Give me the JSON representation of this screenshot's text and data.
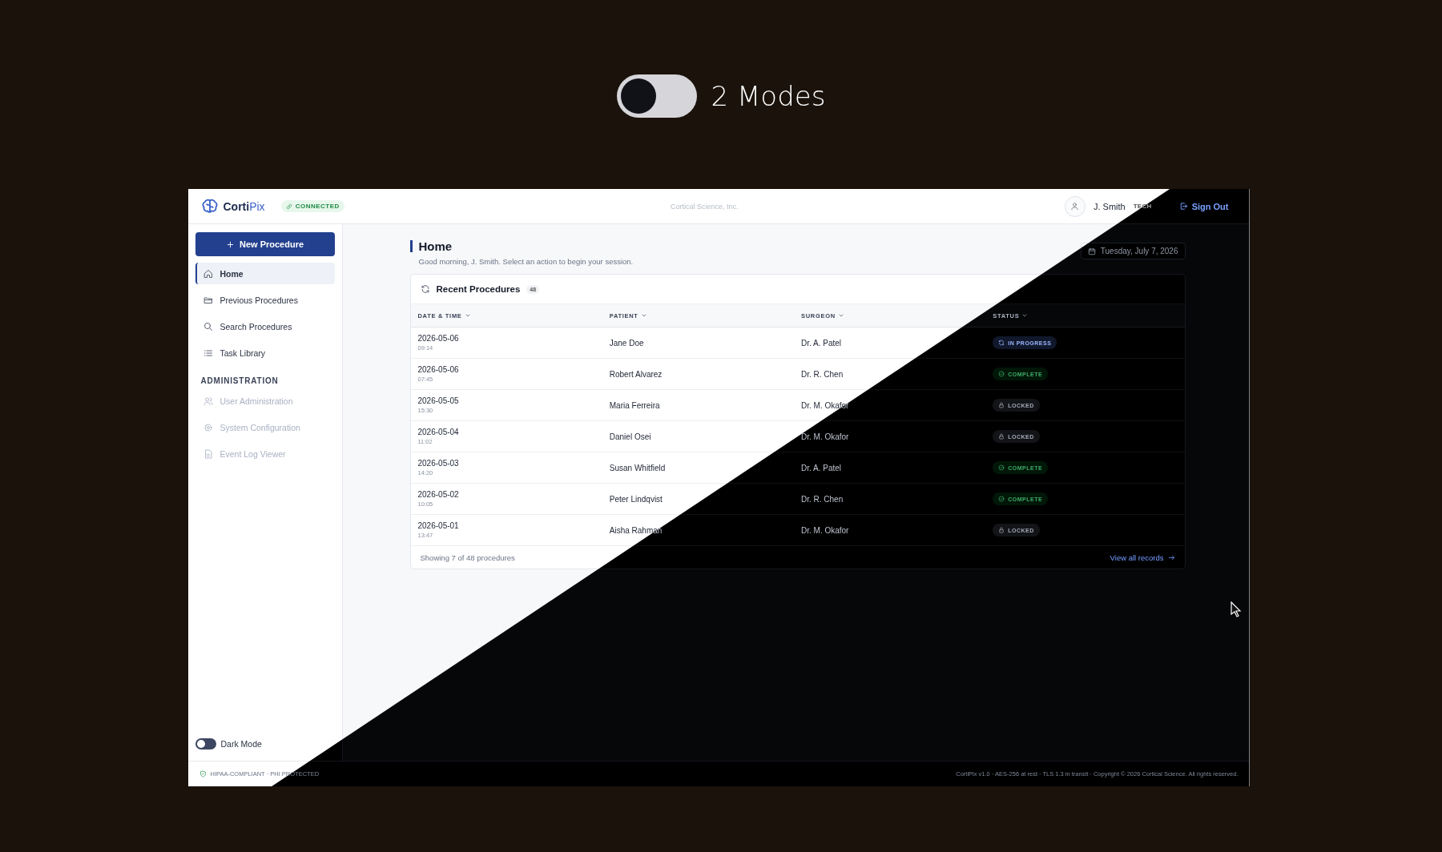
{
  "modes_toggle": {
    "on": false,
    "label": "2 Modes"
  },
  "header": {
    "logo": "**Corti**Pix",
    "connection": "CONNECTED",
    "organization": "Cortical Science, Inc.",
    "user": {
      "name": "J. Smith",
      "role": "TECH"
    },
    "sign_out": "Sign Out"
  },
  "sidebar": {
    "new_button": "New Procedure",
    "nav_items": [
      {
        "label": "Home",
        "selected": true
      },
      {
        "label": "Previous Procedures",
        "selected": false
      },
      {
        "label": "Search Procedures",
        "selected": false
      },
      {
        "label": "Task Library",
        "selected": false
      }
    ],
    "section_title": "ADMINISTRATION",
    "admin_items": [
      {
        "label": "User Administration",
        "disabled": true
      },
      {
        "label": "System Configuration",
        "disabled": true
      },
      {
        "label": "Event Log Viewer",
        "disabled": true
      }
    ],
    "dark_mode": {
      "label": "Dark Mode",
      "on": false
    }
  },
  "page": {
    "title": "Home",
    "subtitle": "Good morning, J. Smith. Select an action to begin your session.",
    "date": "Tuesday, July 7, 2026"
  },
  "table": {
    "title": "Recent Procedures",
    "count": "48",
    "columns": [
      "DATE & TIME",
      "PATIENT",
      "SURGEON",
      "STATUS"
    ],
    "rows": [
      {
        "date": "2026-05-06",
        "time": "09:14",
        "patient": "Jane Doe",
        "surgeon": "Dr. A. Patel",
        "status": {
          "label": "IN PROGRESS",
          "kind": "progress"
        }
      },
      {
        "date": "2026-05-06",
        "time": "07:45",
        "patient": "Robert Alvarez",
        "surgeon": "Dr. R. Chen",
        "status": {
          "label": "COMPLETE",
          "kind": "complete"
        }
      },
      {
        "date": "2026-05-05",
        "time": "15:30",
        "patient": "Maria Ferreira",
        "surgeon": "Dr. M. Okafor",
        "status": {
          "label": "LOCKED",
          "kind": "locked"
        }
      },
      {
        "date": "2026-05-04",
        "time": "11:02",
        "patient": "Daniel Osei",
        "surgeon": "Dr. M. Okafor",
        "status": {
          "label": "LOCKED",
          "kind": "locked"
        }
      },
      {
        "date": "2026-05-03",
        "time": "14:20",
        "patient": "Susan Whitfield",
        "surgeon": "Dr. A. Patel",
        "status": {
          "label": "COMPLETE",
          "kind": "complete"
        }
      },
      {
        "date": "2026-05-02",
        "time": "10:05",
        "patient": "Peter Lindqvist",
        "surgeon": "Dr. R. Chen",
        "status": {
          "label": "COMPLETE",
          "kind": "complete"
        }
      },
      {
        "date": "2026-05-01",
        "time": "13:47",
        "patient": "Aisha Rahman",
        "surgeon": "Dr. M. Okafor",
        "status": {
          "label": "LOCKED",
          "kind": "locked"
        }
      }
    ],
    "footer": "Showing 7 of 48 procedures",
    "view_all": "View all records"
  },
  "status_bar": {
    "left": "HIPAA-COMPLIANT · PHI PROTECTED",
    "right": "CortiPix v1.0 · AES-256 at rest · TLS 1.3 in transit · Copyright © 2026 Cortical Science. All rights reserved."
  }
}
